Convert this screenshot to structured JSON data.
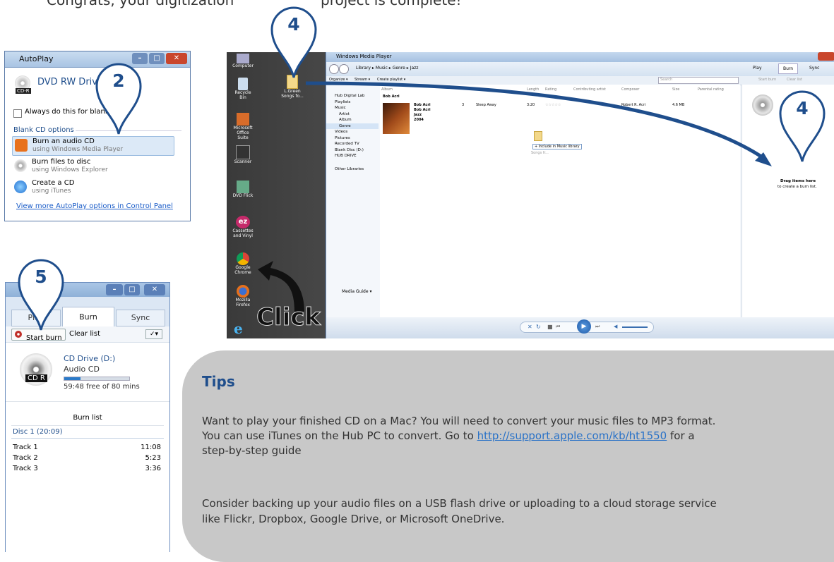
{
  "header": {
    "line_left": "Congrats, your digitization",
    "line_right": "project is complete!"
  },
  "callouts": {
    "autoplay": "2",
    "desktop_top": "4",
    "burn_pane": "4",
    "burn_button": "5"
  },
  "autoplay": {
    "title": "AutoPlay",
    "drive": "DVD RW Drive",
    "drive_badge": "CD-R",
    "checkbox_label": "Always do this for blank CD",
    "section_label": "Blank CD options",
    "options": [
      {
        "title": "Burn an audio CD",
        "sub": "using Windows Media Player"
      },
      {
        "title": "Burn files to disc",
        "sub": "using Windows Explorer"
      },
      {
        "title": "Create a CD",
        "sub": "using iTunes"
      }
    ],
    "more_link": "View more AutoPlay options in Control Panel"
  },
  "desktop": {
    "icons": [
      "Computer",
      "Recycle Bin",
      "Microsoft Office Suite",
      "Scanner",
      "DVD Flick",
      "Cassettes and Vinyl",
      "Google Chrome",
      "Mozilla Firefox"
    ],
    "folder_label": "L.Green Songs fo...",
    "click_text": "Click"
  },
  "wmp": {
    "title": "Windows Media Player",
    "breadcrumb": "Library ▸ Music ▸ Genre ▸ Jazz",
    "tabs": [
      "Play",
      "Burn",
      "Sync"
    ],
    "toolbar": [
      "Organize ▾",
      "Stream ▾",
      "Create playlist ▾"
    ],
    "search_placeholder": "Search",
    "nav": [
      "Hub Digital Lab",
      "Playlists",
      "Music",
      "Artist",
      "Album",
      "Genre",
      "Videos",
      "Pictures",
      "Recorded TV",
      "Blank Disc (D:)",
      "HUB DRIVE",
      "Other Libraries"
    ],
    "columns": [
      "Album",
      "#",
      "Title",
      "Length",
      "Rating",
      "Contributing artist",
      "Composer",
      "Size",
      "Parental rating"
    ],
    "album_header": "Bob Acri",
    "album_info": [
      "Bob Acri",
      "Bob Acri",
      "Jazz",
      "2004"
    ],
    "track": {
      "num": "3",
      "title": "Sleep Away",
      "length": "3:20",
      "rating": "☆☆☆☆☆",
      "composer": "Robert R. Acri",
      "size": "4.6 MB"
    },
    "drag_tip": "+ Include in Music library",
    "drag_file": "Songs fr...",
    "burn_buttons": [
      "Start burn",
      "Clear list"
    ],
    "drag_title": "Drag items here",
    "drag_sub": "to create a burn list.",
    "media_guide": "Media Guide ▾"
  },
  "burn_panel": {
    "tabs": [
      "Play",
      "Burn",
      "Sync"
    ],
    "start_burn": "Start burn",
    "clear_list": "Clear list",
    "drive": "CD Drive (D:)",
    "type": "Audio CD",
    "disc_badge": "CD R",
    "free": "59:48 free of 80 mins",
    "used_fraction": 0.25,
    "list_title": "Burn list",
    "disc_label": "Disc 1 (20:09)",
    "tracks": [
      {
        "name": "Track 1",
        "length": "11:08"
      },
      {
        "name": "Track 2",
        "length": "5:23"
      },
      {
        "name": "Track 3",
        "length": "3:36"
      }
    ]
  },
  "tips": {
    "title": "Tips",
    "para1_a": "Want to play your finished CD on a Mac? You will need to convert your music files to MP3 format.",
    "para1_b": "You can use iTunes on the Hub PC to convert. Go to",
    "para1_link": "http://support.apple.com/kb/ht1550",
    "para1_c": "for a",
    "para1_d": "step-by-step guide",
    "para2_a": "Consider backing up your audio files on a USB flash drive or uploading to a cloud storage service",
    "para2_b": "like Flickr, Dropbox, Google Drive, or Microsoft OneDrive."
  },
  "colors": {
    "accent": "#1f4e8c",
    "tips_bg": "#c8c8c8",
    "link": "#2a72c7"
  }
}
